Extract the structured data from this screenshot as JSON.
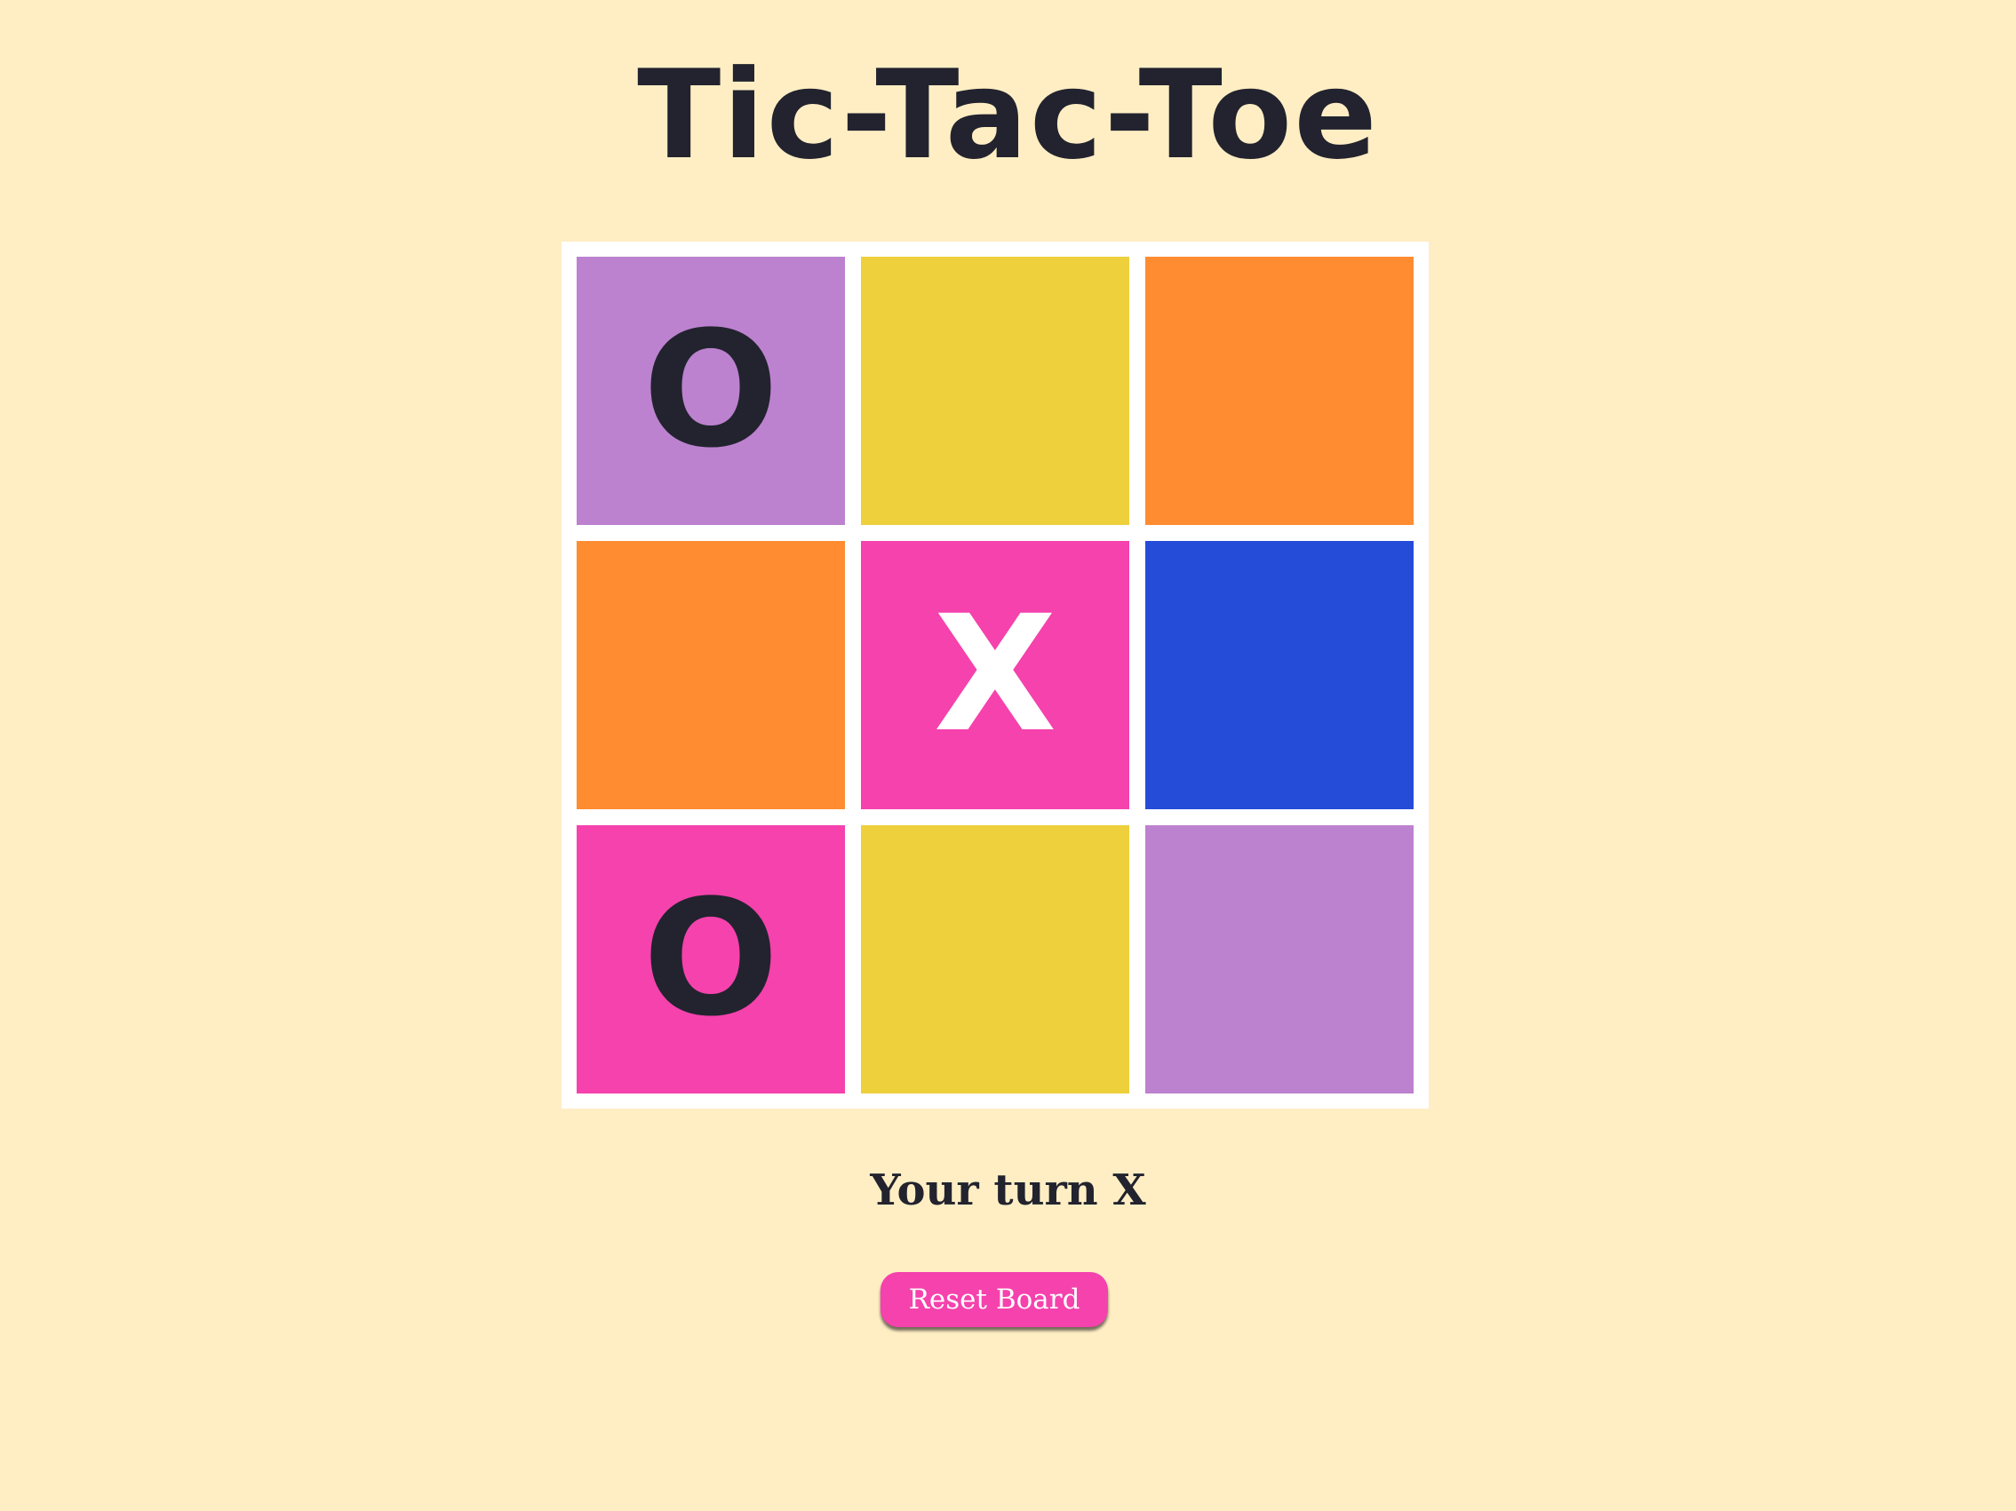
{
  "title": "Tic-Tac-Toe",
  "status_text": "Your turn X",
  "reset_label": "Reset Board",
  "colors": {
    "background": "#ffeec4",
    "board_frame": "#ffffff",
    "text_dark": "#22232e",
    "text_light": "#ffffff",
    "button": "#f542ad"
  },
  "board": {
    "cells": [
      {
        "mark": "O",
        "color": "#bc82cf",
        "mark_color": "#22232e"
      },
      {
        "mark": "",
        "color": "#eed03d",
        "mark_color": "#22232e"
      },
      {
        "mark": "",
        "color": "#ff8c31",
        "mark_color": "#22232e"
      },
      {
        "mark": "",
        "color": "#ff8c31",
        "mark_color": "#22232e"
      },
      {
        "mark": "X",
        "color": "#f542ad",
        "mark_color": "#ffffff"
      },
      {
        "mark": "",
        "color": "#254cd8",
        "mark_color": "#22232e"
      },
      {
        "mark": "O",
        "color": "#f542ad",
        "mark_color": "#22232e"
      },
      {
        "mark": "",
        "color": "#eed03d",
        "mark_color": "#22232e"
      },
      {
        "mark": "",
        "color": "#bc82cf",
        "mark_color": "#22232e"
      }
    ]
  }
}
